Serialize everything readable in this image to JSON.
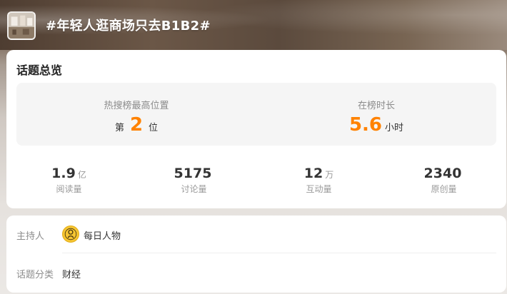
{
  "header": {
    "topic_title": "#年轻人逛商场只去B1B2#"
  },
  "overview": {
    "title": "话题总览",
    "rank": {
      "label": "热搜榜最高位置",
      "prefix": "第",
      "value": "2",
      "suffix": "位"
    },
    "duration": {
      "label": "在榜时长",
      "value": "5.6",
      "unit": "小时"
    },
    "stats": [
      {
        "value": "1.9",
        "unit": "亿",
        "label": "阅读量"
      },
      {
        "value": "5175",
        "unit": "",
        "label": "讨论量"
      },
      {
        "value": "12",
        "unit": "万",
        "label": "互动量"
      },
      {
        "value": "2340",
        "unit": "",
        "label": "原创量"
      }
    ]
  },
  "info": {
    "host_label": "主持人",
    "host_name": "每日人物",
    "category_label": "话题分类",
    "category_value": "财经"
  },
  "colors": {
    "accent": "#ff8200",
    "card_bg": "#ffffff",
    "panel_bg": "#f5f5f5"
  },
  "icons": {
    "topic_thumbnail": "mall-photo-thumbnail",
    "host_avatar": "person-avatar-icon"
  }
}
